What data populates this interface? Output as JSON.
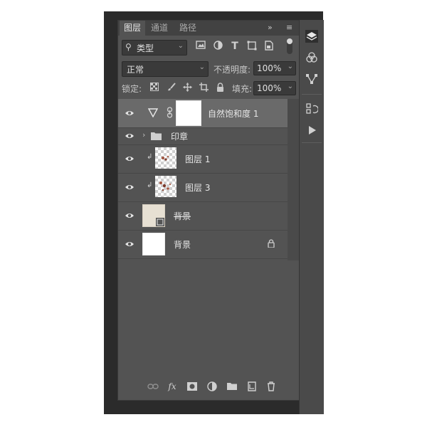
{
  "tabs": [
    "图层",
    "通道",
    "路径"
  ],
  "tab_menu": {
    "expand": "»",
    "menu": "≡"
  },
  "filter": {
    "kind_label": "类型",
    "search_icon": "search-icon"
  },
  "blend_mode": "正常",
  "opacity": {
    "label": "不透明度:",
    "value": "100%"
  },
  "lock": {
    "label": "锁定:"
  },
  "fill": {
    "label": "填充:",
    "value": "100%"
  },
  "layers": [
    {
      "name": "自然饱和度 1",
      "type": "adjustment",
      "selected": true
    },
    {
      "name": "印章",
      "type": "group",
      "collapsed": true
    },
    {
      "name": "图层 1",
      "type": "clipped-pixel"
    },
    {
      "name": "图层 3",
      "type": "clipped-pixel"
    },
    {
      "name": "背景",
      "type": "smart-object",
      "strikethrough": true
    },
    {
      "name": "背景",
      "type": "background",
      "locked": true
    }
  ],
  "bottom_icons": [
    "link-icon",
    "fx-icon",
    "mask-icon",
    "adjustment-icon",
    "folder-icon",
    "new-layer-icon",
    "trash-icon"
  ],
  "fx_label": "fx",
  "dock_icons": [
    "layers-icon",
    "channels-icon",
    "paths-icon",
    "history-icon",
    "actions-icon"
  ]
}
